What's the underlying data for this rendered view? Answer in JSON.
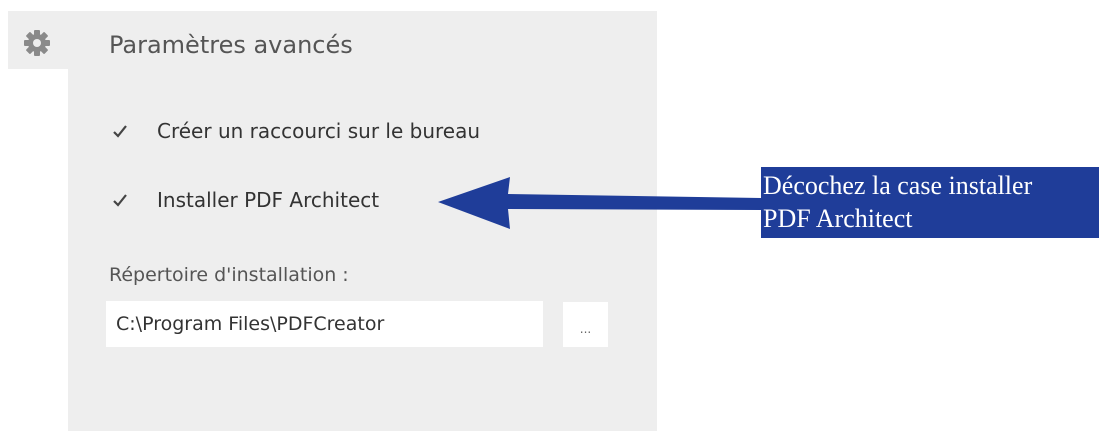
{
  "settings": {
    "title": "Paramètres avancés",
    "icon": "gear-icon",
    "options": [
      {
        "label": "Créer un raccourci sur le bureau",
        "checked": true
      },
      {
        "label": "Installer PDF Architect",
        "checked": true
      }
    ],
    "install_dir": {
      "label": "Répertoire d'installation :",
      "value": "C:\\Program Files\\PDFCreator",
      "browse_label": "..."
    }
  },
  "annotation": {
    "text_line1": "Décochez la case installer",
    "text_line2": "PDF Architect",
    "color": "#1f3d99"
  }
}
